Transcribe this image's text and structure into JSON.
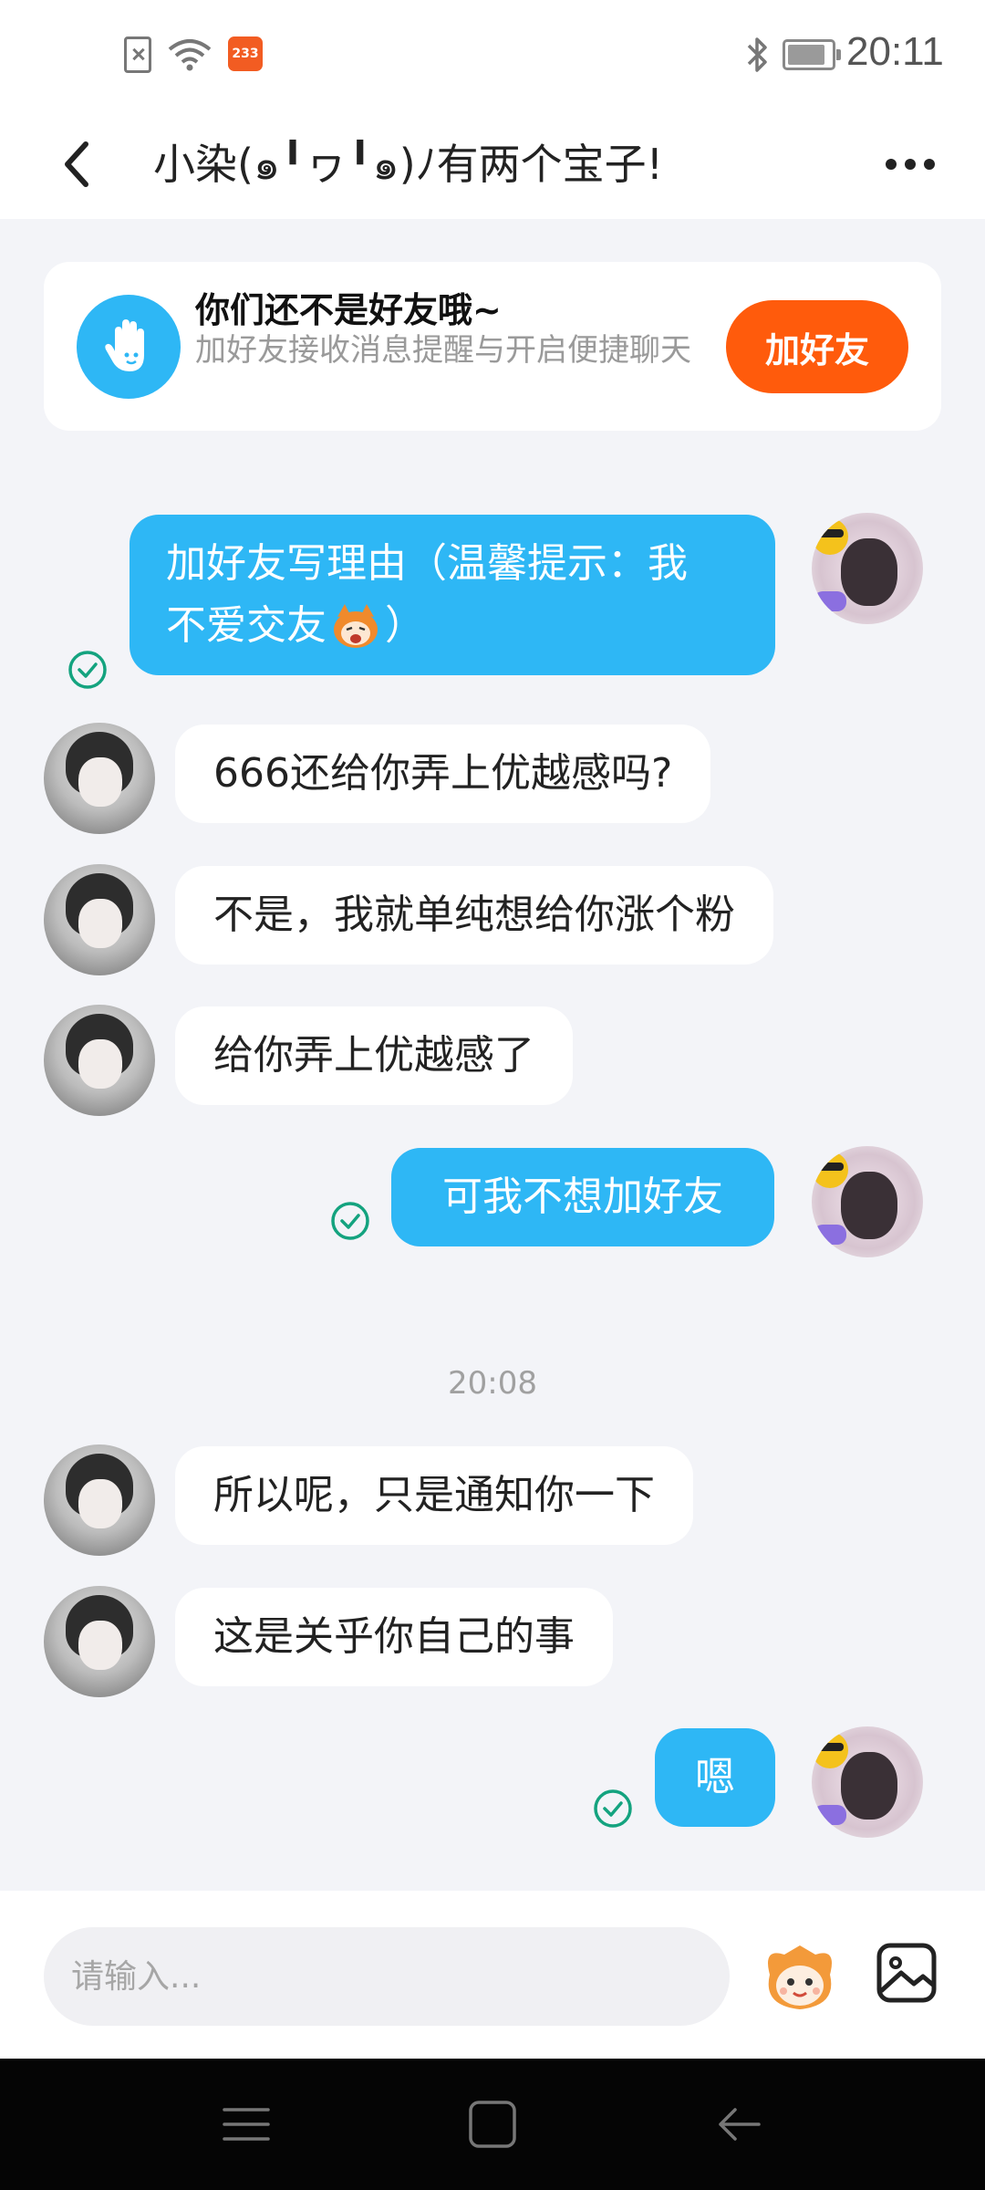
{
  "status_bar": {
    "badge_count": "233",
    "time": "20:11"
  },
  "header": {
    "title": "小染(๑╹ヮ╹๑)ﾉ有两个宝子!"
  },
  "friend_banner": {
    "title": "你们还不是好友哦~",
    "subtitle": "加好友接收消息提醒与开启便捷聊天",
    "button_label": "加好友"
  },
  "messages": [
    {
      "sender": "me",
      "text_line1": "加好友写理由（温馨提示：我",
      "text_line2": "不爱交友",
      "text_tail": "）"
    },
    {
      "sender": "other",
      "text": "666还给你弄上优越感吗?"
    },
    {
      "sender": "other",
      "text": "不是，我就单纯想给你涨个粉"
    },
    {
      "sender": "other",
      "text": "给你弄上优越感了"
    },
    {
      "sender": "me",
      "text": "可我不想加好友"
    },
    {
      "sender": "other",
      "text": "所以呢，只是通知你一下"
    },
    {
      "sender": "other",
      "text": "这是关乎你自己的事"
    },
    {
      "sender": "me",
      "text": "嗯"
    }
  ],
  "timestamp": "20:08",
  "input": {
    "placeholder": "请输入..."
  },
  "colors": {
    "accent_blue": "#2eb7f5",
    "add_friend_orange": "#ff5b0c",
    "read_check_green": "#14a37f"
  },
  "icons": {
    "back": "chevron-left-icon",
    "more": "more-dots-icon",
    "banner": "hand-wave-icon",
    "read": "check-circle-icon",
    "mascot": "mascot-emoji-icon",
    "image": "image-icon"
  }
}
